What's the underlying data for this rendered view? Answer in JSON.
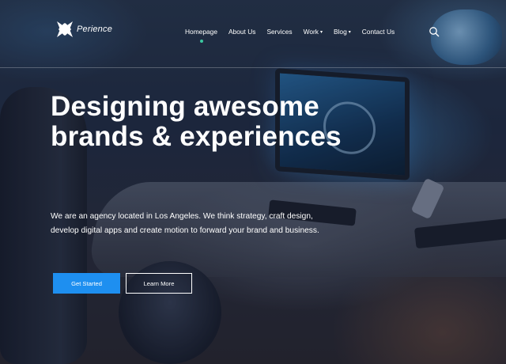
{
  "brand": {
    "logo_text": "Perience"
  },
  "nav": {
    "items": [
      {
        "label": "Homepage"
      },
      {
        "label": "About Us"
      },
      {
        "label": "Services"
      },
      {
        "label": "Work"
      },
      {
        "label": "Blog"
      },
      {
        "label": "Contact Us"
      }
    ],
    "active": "Homepage"
  },
  "icons": {
    "search": "search-icon",
    "logo": "x-logo-icon",
    "dropdown": "chevron-down-icon"
  },
  "hero": {
    "title_line1": "Designing awesome",
    "title_line2": "brands & experiences",
    "subtitle": "We are an agency located in Los Angeles. We think strategy, craft design, develop digital apps and create motion to forward your brand and business.",
    "primary_button": "Get Started",
    "secondary_button": "Learn More"
  },
  "colors": {
    "accent": "#1e8ff0",
    "active_indicator": "#3cc7a0",
    "text": "#ffffff"
  }
}
